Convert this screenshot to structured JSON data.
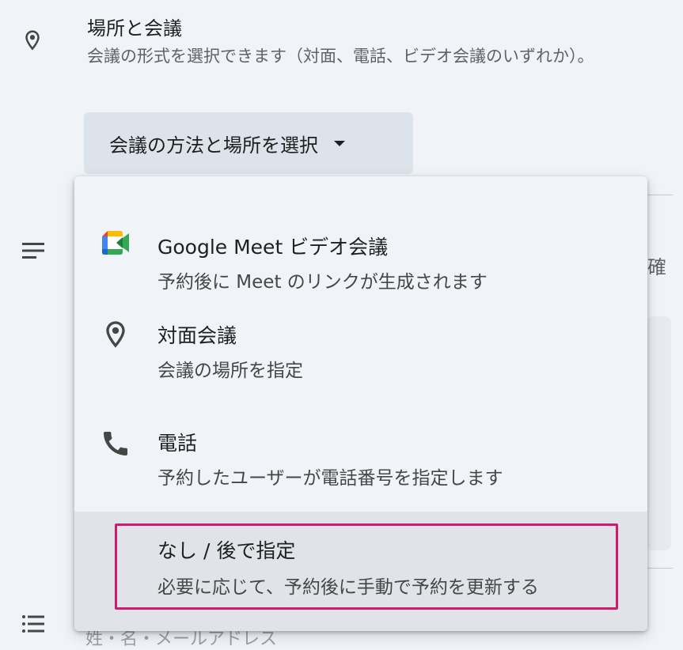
{
  "section": {
    "title": "場所と会議",
    "description": "会議の形式を選択できます（対面、電話、ビデオ会議のいずれか）。"
  },
  "select": {
    "label": "会議の方法と場所を選択"
  },
  "background": {
    "partial_right": "確",
    "partial_bottom": "姓・名・メールアドレス"
  },
  "menu": {
    "items": [
      {
        "icon": "google-meet-icon",
        "title": "Google Meet ビデオ会議",
        "subtitle": "予約後に Meet のリンクが生成されます"
      },
      {
        "icon": "location-pin-icon",
        "title": "対面会議",
        "subtitle": "会議の場所を指定"
      },
      {
        "icon": "phone-icon",
        "title": "電話",
        "subtitle": "予約したユーザーが電話番号を指定します"
      },
      {
        "icon": "",
        "title": "なし / 後で指定",
        "subtitle": "必要に応じて、予約後に手動で予約を更新する",
        "selected": true
      }
    ]
  },
  "colors": {
    "page_background": "#f0f4f9",
    "select_background": "#dde3ea",
    "hovered_item": "#e0e4e8",
    "highlight_border": "#d01a6b",
    "meet_blue": "#4285F4",
    "meet_red": "#EA4335",
    "meet_yellow": "#FBBC04",
    "meet_green": "#34A853",
    "meet_dark_green": "#188038"
  }
}
